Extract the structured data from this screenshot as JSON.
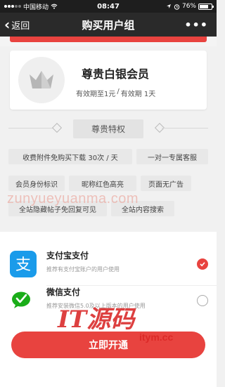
{
  "status_bar": {
    "carrier": "中国移动",
    "time": "08:47",
    "battery": "76%",
    "battery_level": 0.76
  },
  "nav": {
    "back_label": "返回",
    "title": "购买用户组",
    "more": "•••"
  },
  "member": {
    "title": "尊贵白银会员",
    "validity_1": "有效期至1元",
    "validity_sep": "/",
    "validity_2": "有效期 1天"
  },
  "privileges": {
    "title": "尊贵特权",
    "tags": [
      "收费附件免购买下载 30次 / 天",
      "一对一专属客服",
      "会员身份标识",
      "昵称红色高亮",
      "页面无广告",
      "全站隐藏帖子免回复可见",
      "全站内容搜索"
    ]
  },
  "payment": {
    "options": [
      {
        "name": "支付宝支付",
        "desc": "推荐有支付宝账户的用户使用",
        "selected": true
      },
      {
        "name": "微信支付",
        "desc": "推荐安装微信5.0及以上版本的用户使用",
        "selected": false
      }
    ],
    "button_label": "立即开通"
  },
  "watermark": {
    "url": "zunyueyuanma.com",
    "logo": "IT源码",
    "domain": "itym.cc"
  },
  "colors": {
    "accent": "#e8433f",
    "alipay": "#1a9bea",
    "wechat": "#1aad19",
    "navbar": "#2a2a2a"
  }
}
